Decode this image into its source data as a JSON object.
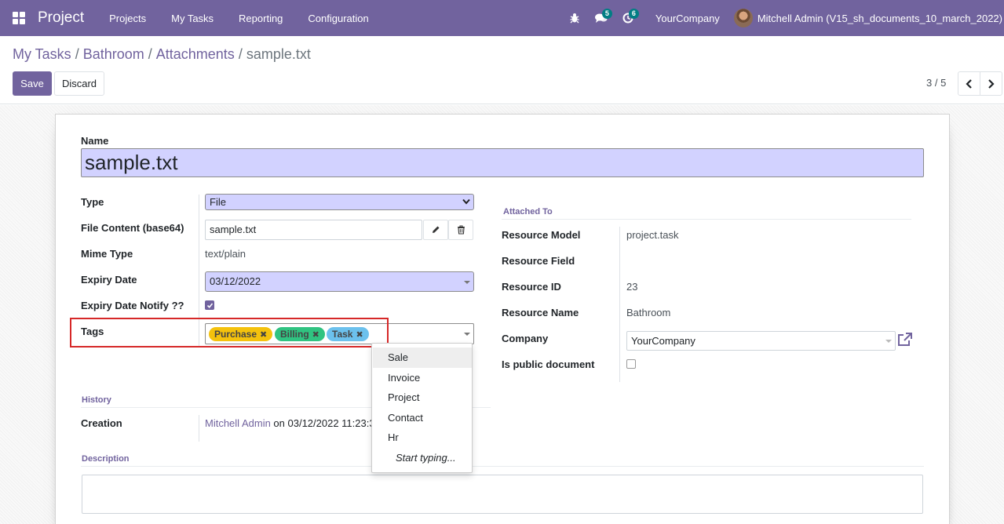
{
  "navbar": {
    "app_name": "Project",
    "menu": [
      "Projects",
      "My Tasks",
      "Reporting",
      "Configuration"
    ],
    "messages_count": "5",
    "activities_count": "6",
    "company": "YourCompany",
    "user": "Mitchell Admin (V15_sh_documents_10_march_2022)"
  },
  "breadcrumb": {
    "items": [
      "My Tasks",
      "Bathroom",
      "Attachments"
    ],
    "separator": "/",
    "current": "sample.txt"
  },
  "actions": {
    "save_label": "Save",
    "discard_label": "Discard",
    "pager": "3 / 5"
  },
  "form": {
    "name_label": "Name",
    "name_value": "sample.txt",
    "type_label": "Type",
    "type_value": "File",
    "file_content_label": "File Content (base64)",
    "file_content_value": "sample.txt",
    "mime_label": "Mime Type",
    "mime_value": "text/plain",
    "expiry_label": "Expiry Date",
    "expiry_value": "03/12/2022",
    "expiry_notify_label": "Expiry Date Notify ??",
    "expiry_notify_checked": true,
    "tags_label": "Tags",
    "tags": [
      {
        "label": "Purchase",
        "color": "#f4c20d"
      },
      {
        "label": "Billing",
        "color": "#30c381"
      },
      {
        "label": "Task",
        "color": "#6cc1ed"
      }
    ],
    "attached_to_title": "Attached To",
    "resource_model_label": "Resource Model",
    "resource_model_value": "project.task",
    "resource_field_label": "Resource Field",
    "resource_field_value": "",
    "resource_id_label": "Resource ID",
    "resource_id_value": "23",
    "resource_name_label": "Resource Name",
    "resource_name_value": "Bathroom",
    "company_label": "Company",
    "company_value": "YourCompany",
    "public_label": "Is public document",
    "public_checked": false,
    "history_title": "History",
    "creation_label": "Creation",
    "creation_user": "Mitchell Admin",
    "creation_on": " on 03/12/2022 11:23:3",
    "description_title": "Description"
  },
  "tags_dropdown": {
    "options": [
      "Sale",
      "Invoice",
      "Project",
      "Contact",
      "Hr"
    ],
    "hint": "Start typing..."
  },
  "colors": {
    "brand": "#71639e",
    "required_field": "#d2d2ff",
    "highlight_border": "#d62828"
  }
}
